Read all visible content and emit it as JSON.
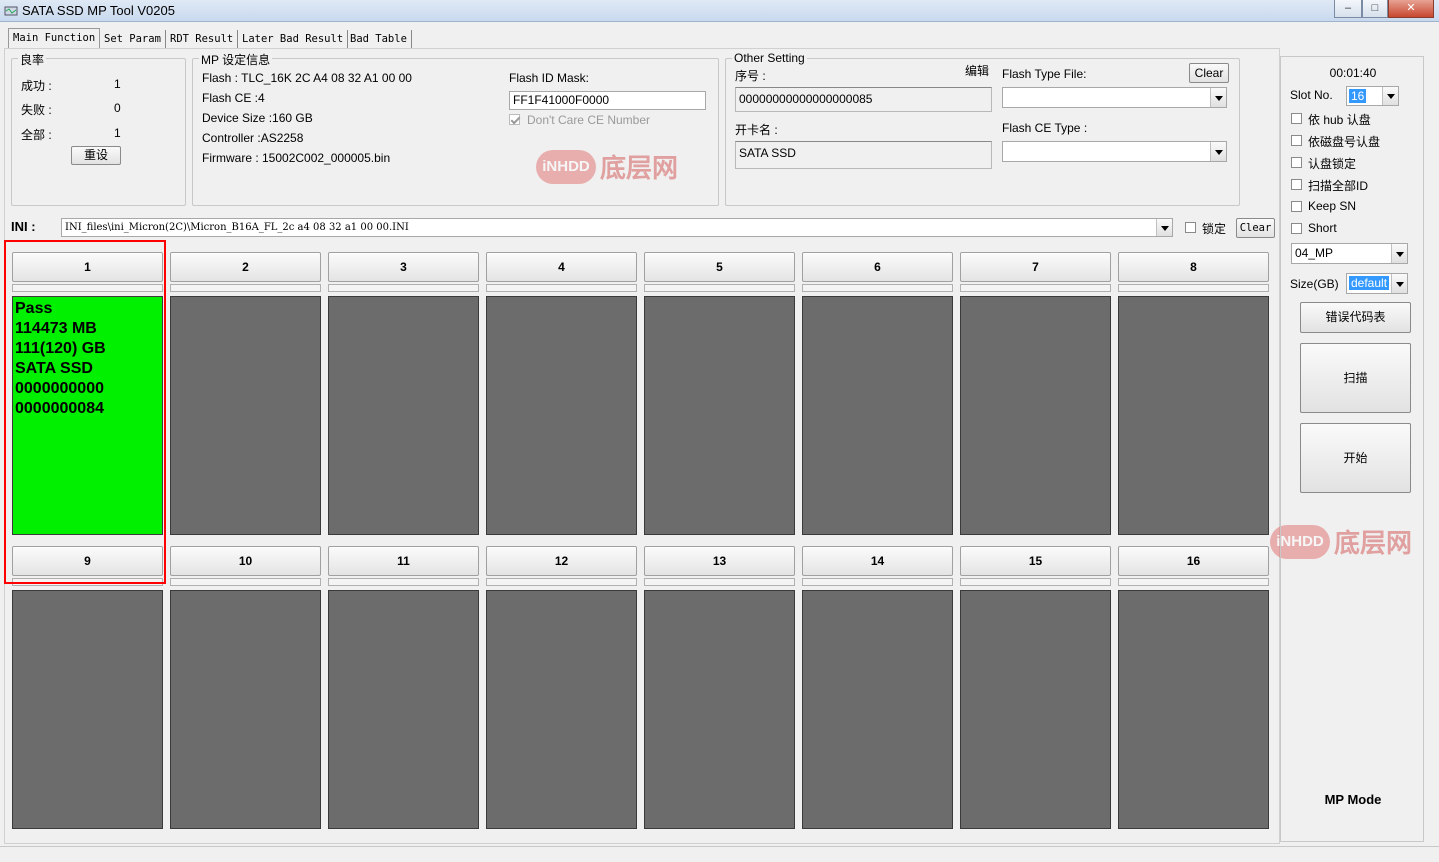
{
  "window": {
    "title": "SATA SSD MP Tool V0205",
    "minimize": "–",
    "maximize": "□",
    "close": "✕"
  },
  "tabs": [
    "Main Function",
    "Set Param",
    "RDT Result",
    "Later Bad Result",
    "Bad Table"
  ],
  "yield": {
    "title": "良率",
    "success_label": "成功 :",
    "success_value": "1",
    "fail_label": "失败 :",
    "fail_value": "0",
    "total_label": "全部 :",
    "total_value": "1",
    "reset_button": "重设"
  },
  "mp_info": {
    "title": "MP 设定信息",
    "flash": "Flash : TLC_16K 2C A4 08 32 A1 00 00",
    "flash_ce": "Flash CE :4",
    "device_size": "Device Size :160 GB",
    "controller": "Controller :AS2258",
    "firmware": "Firmware : 15002C002_000005.bin",
    "flash_id_mask_label": "Flash ID Mask:",
    "flash_id_mask_value": "FF1F41000F0000",
    "dont_care_ce": "Don't Care CE Number"
  },
  "other_setting": {
    "title": "Other Setting",
    "serial_label": "序号 :",
    "edit_button": "编辑",
    "serial_value": "00000000000000000085",
    "card_name_label": "开卡名 :",
    "card_name_value": "SATA SSD",
    "flash_type_file_label": "Flash Type File:",
    "clear_button": "Clear",
    "flash_type_file_value": "",
    "flash_ce_type_label": "Flash CE Type :",
    "flash_ce_type_value": ""
  },
  "ini": {
    "label": "INI :",
    "value": "INI_files\\ini_Micron(2C)\\Micron_B16A_FL_2c a4 08 32 a1 00 00.INI",
    "lock_label": "锁定",
    "clear_button": "Clear"
  },
  "slots": [
    {
      "num": "1",
      "pass": true,
      "info": "Pass\n114473 MB\n111(120) GB\nSATA SSD\n0000000000\n0000000084"
    },
    {
      "num": "2",
      "pass": false,
      "info": ""
    },
    {
      "num": "3",
      "pass": false,
      "info": ""
    },
    {
      "num": "4",
      "pass": false,
      "info": ""
    },
    {
      "num": "5",
      "pass": false,
      "info": ""
    },
    {
      "num": "6",
      "pass": false,
      "info": ""
    },
    {
      "num": "7",
      "pass": false,
      "info": ""
    },
    {
      "num": "8",
      "pass": false,
      "info": ""
    },
    {
      "num": "9",
      "pass": false,
      "info": ""
    },
    {
      "num": "10",
      "pass": false,
      "info": ""
    },
    {
      "num": "11",
      "pass": false,
      "info": ""
    },
    {
      "num": "12",
      "pass": false,
      "info": ""
    },
    {
      "num": "13",
      "pass": false,
      "info": ""
    },
    {
      "num": "14",
      "pass": false,
      "info": ""
    },
    {
      "num": "15",
      "pass": false,
      "info": ""
    },
    {
      "num": "16",
      "pass": false,
      "info": ""
    }
  ],
  "right_panel": {
    "timer": "00:01:40",
    "slot_no_label": "Slot No.",
    "slot_no_value": "16",
    "options": [
      "依 hub 认盘",
      "依磁盘号认盘",
      "认盘锁定",
      "扫描全部ID",
      "Keep SN",
      "Short"
    ],
    "mode_value": "04_MP",
    "size_label": "Size(GB)",
    "size_value": "default",
    "error_code_button": "错误代码表",
    "scan_button": "扫描",
    "start_button": "开始",
    "mode_text": "MP Mode"
  },
  "watermark": {
    "badge": "iNHDD",
    "text": "底层网"
  },
  "colors": {
    "pass": "#00f000",
    "idle": "#6c6c6c",
    "highlight": "#ff0000"
  }
}
